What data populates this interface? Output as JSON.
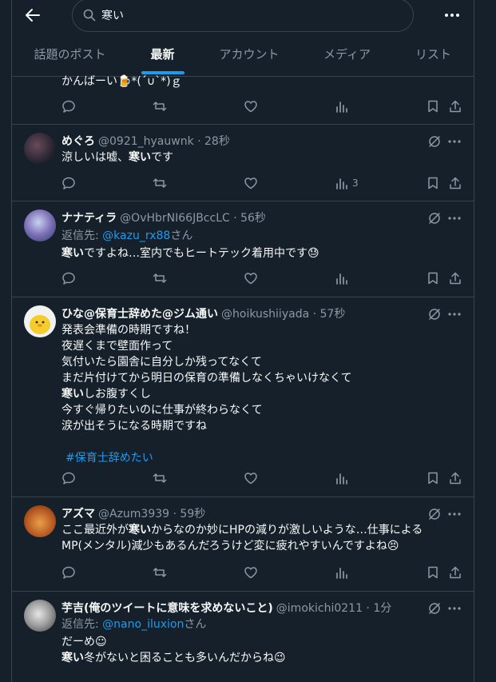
{
  "header": {
    "search_value": "寒い",
    "icons": [
      "back-arrow-icon",
      "search-icon",
      "more-icon"
    ]
  },
  "tabs": [
    {
      "label": "話題のポスト",
      "active": false
    },
    {
      "label": "最新",
      "active": true
    },
    {
      "label": "アカウント",
      "active": false
    },
    {
      "label": "メディア",
      "active": false
    },
    {
      "label": "リスト",
      "active": false
    }
  ],
  "colors": {
    "background": "#15202b",
    "accent": "#1d9bf0",
    "muted": "#8b98a5",
    "border": "#38444d"
  },
  "tweets": [
    {
      "partial_text": "かんばーい🍺*(´∪`*)ｇ"
    },
    {
      "name": "めぐろ",
      "handle_time": "@0921_hyauwnk · 28秒",
      "line1_pre": "涼しいは嘘、",
      "line1_bold": "寒い",
      "line1_post": "です",
      "views": "3"
    },
    {
      "name": "ナナティラ",
      "handle_time": "@OvHbrNI66JBccLC · 56秒",
      "reply_prefix": "返信先:",
      "reply_to": "@kazu_rx88",
      "reply_suffix": "さん",
      "line1_bold": "寒い",
      "line1_post": "ですよね…室内でもヒートテック着用中です😓"
    },
    {
      "name": "ひな@保育士辞めた@ジム通い",
      "handle_time": "@hoikushiiyada · 57秒",
      "lines": [
        "発表会準備の時期ですね！",
        "夜遅くまで壁面作って",
        "気付いたら園舎に自分しか残ってなくて",
        "まだ片付けてから明日の保育の準備しなくちゃいけなくて"
      ],
      "line5_bold": "寒い",
      "line5_post": "しお腹すくし",
      "lines_after": [
        "今すぐ帰りたいのに仕事が終わらなくて",
        "涙が出そうになる時期ですね"
      ],
      "hashtag": "#保育士辞めたい"
    },
    {
      "name": "アズマ",
      "handle_time": "@Azum3939 · 59秒",
      "line1_pre": "ここ最近外が",
      "line1_bold": "寒い",
      "line1_post": "からなのか妙にHPの減りが激しいような…仕事による",
      "line2": "MP(メンタル)減少もあるんだろうけど変に疲れやすいんですよね😣"
    },
    {
      "name": "芋吉(俺のツイートに意味を求めないこと)",
      "handle_time": "@imokichi0211 · 1分",
      "reply_prefix": "返信先:",
      "reply_to": "@nano_iluxion",
      "reply_suffix": "さん",
      "line1": "だーめ☺",
      "line2_bold": "寒い",
      "line2_post": "冬がないと困ることも多いんだからね😉"
    }
  ]
}
